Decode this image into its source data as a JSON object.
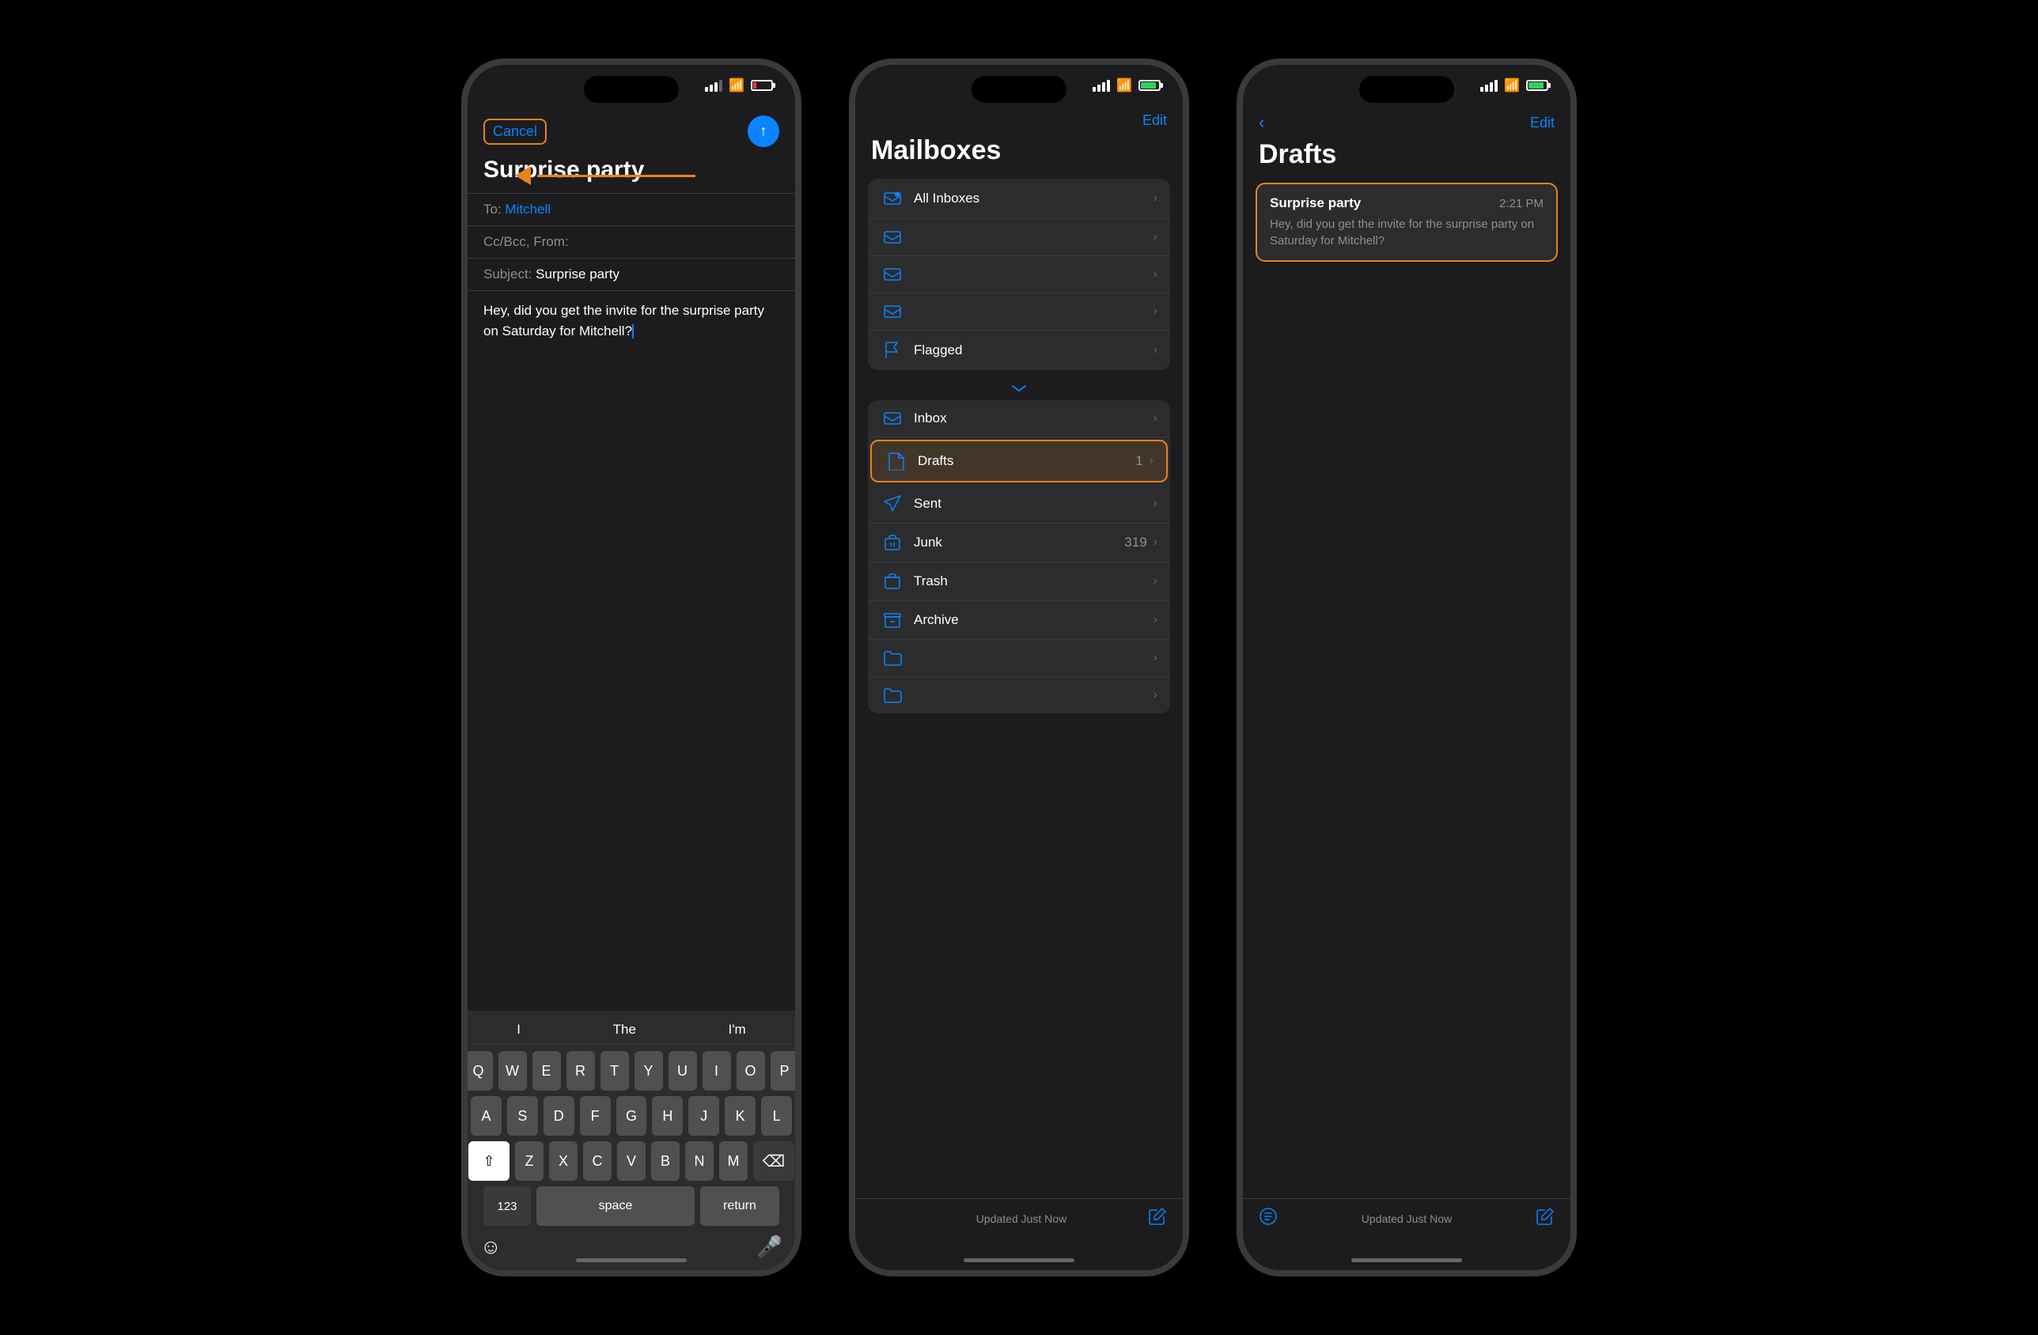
{
  "phone1": {
    "status": {
      "signal": "signal",
      "wifi": "wifi",
      "battery": "low"
    },
    "header": {
      "cancel_label": "Cancel",
      "send_icon": "↑"
    },
    "email": {
      "title": "Surprise party",
      "to_label": "To:",
      "to_value": "Mitchell",
      "cc_label": "Cc/Bcc, From:",
      "subject_label": "Subject:",
      "subject_value": "Surprise party",
      "body": "Hey, did you get the invite for the surprise party on Saturday for Mitchell?"
    },
    "keyboard": {
      "suggestions": [
        "I",
        "The",
        "I'm"
      ],
      "rows": [
        [
          "Q",
          "W",
          "E",
          "R",
          "T",
          "Y",
          "U",
          "I",
          "O",
          "P"
        ],
        [
          "A",
          "S",
          "D",
          "F",
          "G",
          "H",
          "J",
          "K",
          "L"
        ],
        [
          "Z",
          "X",
          "C",
          "V",
          "B",
          "N",
          "M"
        ],
        [
          "123",
          "space",
          "return"
        ]
      ],
      "delete": "⌫"
    }
  },
  "phone2": {
    "status": {
      "signal": "signal",
      "wifi": "wifi",
      "battery": "charging"
    },
    "header": {
      "edit_label": "Edit"
    },
    "title": "Mailboxes",
    "sections": {
      "section1": [
        {
          "icon": "inbox-all",
          "label": "All Inboxes",
          "count": "",
          "highlighted": false
        },
        {
          "icon": "inbox",
          "label": "",
          "count": "",
          "highlighted": false
        },
        {
          "icon": "inbox",
          "label": "",
          "count": "",
          "highlighted": false
        },
        {
          "icon": "inbox",
          "label": "",
          "count": "",
          "highlighted": false
        },
        {
          "icon": "flag",
          "label": "Flagged",
          "count": "",
          "highlighted": false
        }
      ],
      "section2": [
        {
          "icon": "inbox",
          "label": "Inbox",
          "count": "",
          "highlighted": false
        },
        {
          "icon": "doc",
          "label": "Drafts",
          "count": "1",
          "highlighted": true
        },
        {
          "icon": "send",
          "label": "Sent",
          "count": "",
          "highlighted": false
        },
        {
          "icon": "junk",
          "label": "Junk",
          "count": "319",
          "highlighted": false
        },
        {
          "icon": "trash",
          "label": "Trash",
          "count": "",
          "highlighted": false
        },
        {
          "icon": "archive",
          "label": "Archive",
          "count": "",
          "highlighted": false
        },
        {
          "icon": "folder",
          "label": "",
          "count": "",
          "highlighted": false
        },
        {
          "icon": "folder2",
          "label": "",
          "count": "",
          "highlighted": false
        }
      ]
    },
    "toolbar": {
      "status": "Updated Just Now",
      "compose_icon": "compose"
    }
  },
  "phone3": {
    "status": {
      "signal": "signal",
      "wifi": "wifi",
      "battery": "charging"
    },
    "nav": {
      "back_icon": "‹",
      "edit_label": "Edit"
    },
    "title": "Drafts",
    "draft": {
      "subject": "Surprise party",
      "time": "2:21 PM",
      "preview": "Hey, did you get the invite for the surprise party on Saturday for Mitchell?"
    },
    "toolbar": {
      "status": "Updated Just Now",
      "filter_icon": "filter",
      "compose_icon": "compose"
    }
  },
  "annotation": {
    "arrow_color": "#e8821a"
  }
}
